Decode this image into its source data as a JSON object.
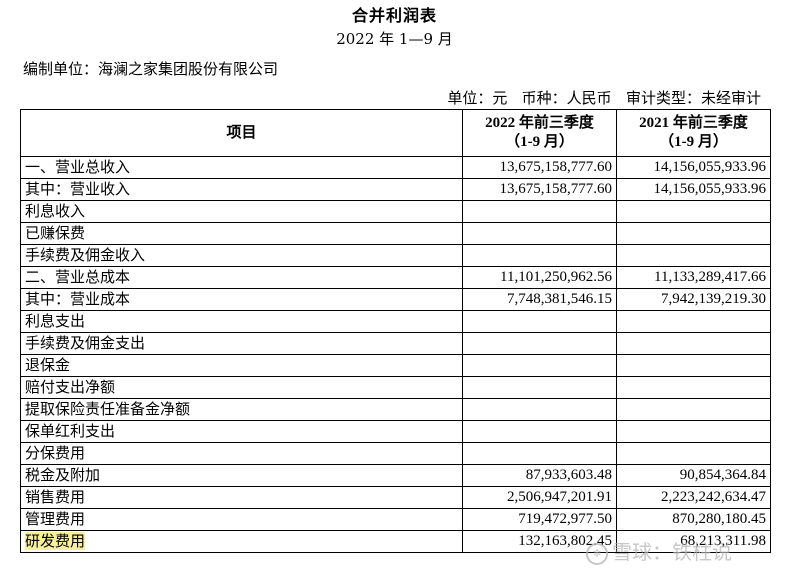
{
  "document": {
    "title": "合并利润表",
    "period": "2022 年 1—9 月",
    "company": "编制单位：海澜之家集团股份有限公司",
    "meta": "单位：元   币种：人民币   审计类型：未经审计"
  },
  "table": {
    "headers": {
      "item": "项目",
      "col1_line1": "2022 年前三季度",
      "col1_line2": "（1-9 月）",
      "col2_line1": "2021 年前三季度",
      "col2_line2": "（1-9 月）"
    },
    "rows": [
      {
        "label": "一、营业总收入",
        "v2022": "13,675,158,777.60",
        "v2021": "14,156,055,933.96"
      },
      {
        "label": "其中：营业收入",
        "v2022": "13,675,158,777.60",
        "v2021": "14,156,055,933.96"
      },
      {
        "label": "利息收入",
        "v2022": "",
        "v2021": ""
      },
      {
        "label": "已赚保费",
        "v2022": "",
        "v2021": ""
      },
      {
        "label": "手续费及佣金收入",
        "v2022": "",
        "v2021": ""
      },
      {
        "label": "二、营业总成本",
        "v2022": "11,101,250,962.56",
        "v2021": "11,133,289,417.66"
      },
      {
        "label": "其中：营业成本",
        "v2022": "7,748,381,546.15",
        "v2021": "7,942,139,219.30"
      },
      {
        "label": "利息支出",
        "v2022": "",
        "v2021": ""
      },
      {
        "label": "手续费及佣金支出",
        "v2022": "",
        "v2021": ""
      },
      {
        "label": "退保金",
        "v2022": "",
        "v2021": ""
      },
      {
        "label": "赔付支出净额",
        "v2022": "",
        "v2021": ""
      },
      {
        "label": "提取保险责任准备金净额",
        "v2022": "",
        "v2021": ""
      },
      {
        "label": "保单红利支出",
        "v2022": "",
        "v2021": ""
      },
      {
        "label": "分保费用",
        "v2022": "",
        "v2021": ""
      },
      {
        "label": "税金及附加",
        "v2022": "87,933,603.48",
        "v2021": "90,854,364.84"
      },
      {
        "label": "销售费用",
        "v2022": "2,506,947,201.91",
        "v2021": "2,223,242,634.47"
      },
      {
        "label": "管理费用",
        "v2022": "719,472,977.50",
        "v2021": "870,280,180.45"
      },
      {
        "label": "研发费用",
        "v2022": "132,163,802.45",
        "v2021": "68,213,311.98"
      }
    ]
  },
  "watermark": "雪球：铁柱说"
}
